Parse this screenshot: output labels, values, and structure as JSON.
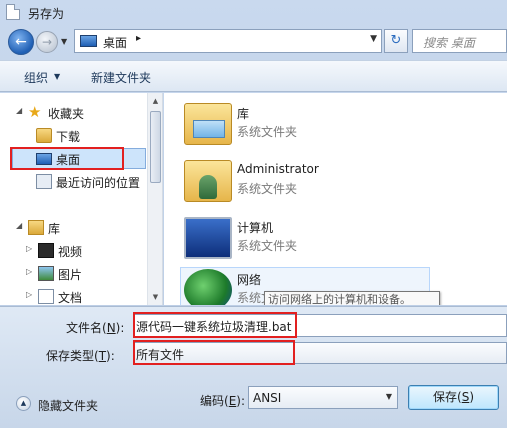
{
  "window": {
    "title": "另存为"
  },
  "address": {
    "location": "桌面",
    "separator": "▸",
    "search_placeholder": "搜索 桌面"
  },
  "toolbar": {
    "organize": "组织",
    "new_folder": "新建文件夹"
  },
  "nav": {
    "items": [
      {
        "label": "收藏夹",
        "icon": "star-icon"
      },
      {
        "label": "下载",
        "icon": "download-folder-icon"
      },
      {
        "label": "桌面",
        "icon": "desktop-icon",
        "selected": true
      },
      {
        "label": "最近访问的位置",
        "icon": "recent-places-icon"
      },
      {
        "label": "库",
        "icon": "library-icon"
      },
      {
        "label": "视频",
        "icon": "video-icon"
      },
      {
        "label": "图片",
        "icon": "pictures-icon"
      },
      {
        "label": "文档",
        "icon": "documents-icon"
      }
    ]
  },
  "files": [
    {
      "name": "库",
      "type": "系统文件夹",
      "icon": "library-icon"
    },
    {
      "name": "Administrator",
      "type": "系统文件夹",
      "icon": "user-folder-icon"
    },
    {
      "name": "计算机",
      "type": "系统文件夹",
      "icon": "computer-icon"
    },
    {
      "name": "网络",
      "type": "系统文件夹",
      "icon": "network-icon"
    }
  ],
  "tooltip": "访问网络上的计算机和设备。",
  "form": {
    "filename_label": "文件名(",
    "filename_key": "N",
    "filename_label_end": "):",
    "filename_value": "源代码一键系统垃圾清理.bat",
    "filetype_label": "保存类型(",
    "filetype_key": "T",
    "filetype_label_end": "):",
    "filetype_value": "所有文件",
    "hide_folders": "隐藏文件夹",
    "encoding_label": "编码(",
    "encoding_key": "E",
    "encoding_label_end": "):",
    "encoding_value": "ANSI",
    "save_label": "保存(",
    "save_key": "S",
    "save_label_end": ")"
  },
  "colors": {
    "highlight": "#e22020",
    "selection": "#cde4fb"
  }
}
